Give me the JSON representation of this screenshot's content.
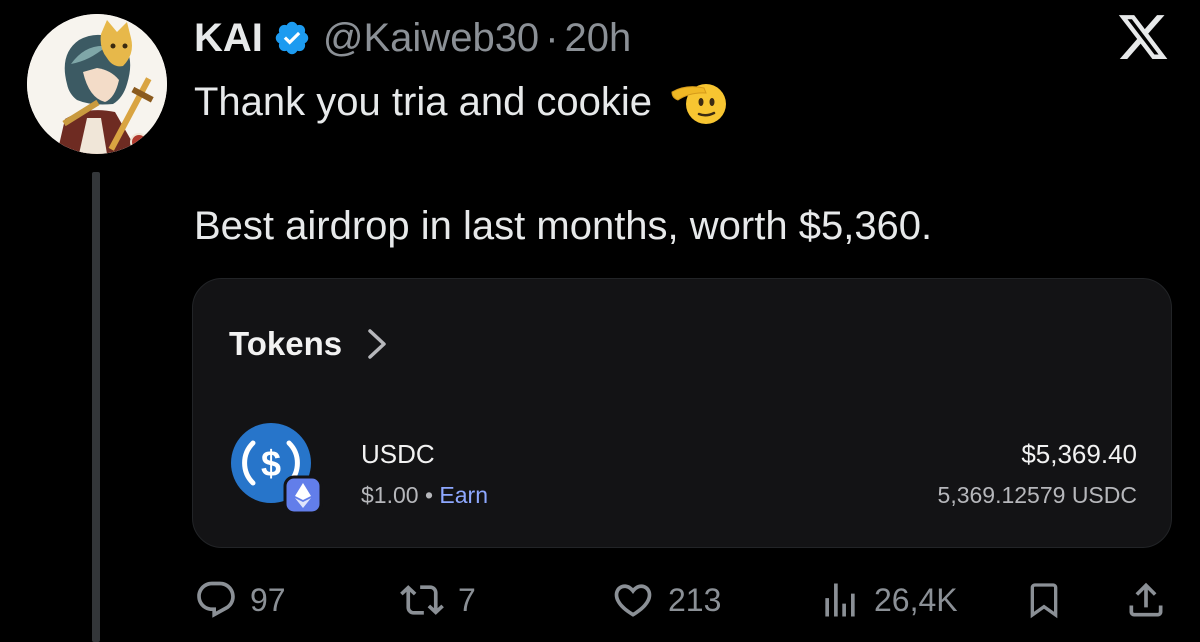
{
  "author": {
    "display_name": "KAI",
    "handle": "@Kaiweb30",
    "separator": "·",
    "time": "20h"
  },
  "icons": {
    "verified": "verified-badge-icon",
    "platform": "x-logo-icon",
    "emoji": "saluting-face-emoji"
  },
  "tweet": {
    "line1": "Thank you tria and cookie",
    "line2": "Best airdrop in last months, worth $5,360."
  },
  "card": {
    "title": "Tokens",
    "token": {
      "name": "USDC",
      "price": "$1.00",
      "separator": "•",
      "earn_label": "Earn",
      "value": "$5,369.40",
      "amount": "5,369.12579 USDC"
    }
  },
  "actions": {
    "replies": "97",
    "reposts": "7",
    "likes": "213",
    "views": "26,4K"
  },
  "colors": {
    "background": "#000000",
    "text": "#e7e9ea",
    "muted": "#8b9096",
    "verified": "#1d9bf0",
    "card_background": "#131315",
    "usdc_blue": "#2775ca",
    "eth_purple": "#627eea",
    "earn_link": "#8ea8ff"
  }
}
